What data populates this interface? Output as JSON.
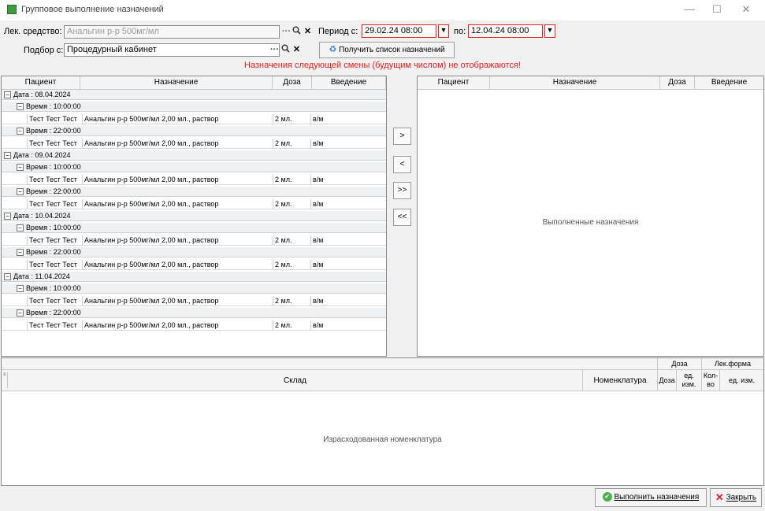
{
  "window": {
    "title": "Групповое выполнение назначений",
    "minimize": "—",
    "maximize": "☐",
    "close": "✕"
  },
  "filters": {
    "drug_label": "Лек. средство:",
    "drug_value": "Анальгин р-р 500мг/мл",
    "period_from_label": "Период с:",
    "period_from_value": "29.02.24 08:00",
    "period_to_label": "по:",
    "period_to_value": "12.04.24 08:00",
    "selection_label": "Подбор с:",
    "selection_value": "Процедурный кабинет",
    "get_list_button": "Получить список назначений",
    "warning": "Назначения следующей смены (будущим числом) не отображаются!"
  },
  "left_grid": {
    "columns": [
      "Пациент",
      "Назначение",
      "Доза",
      "Введение"
    ],
    "rows": [
      {
        "kind": "date",
        "label": "Дата : 08.04.2024"
      },
      {
        "kind": "time",
        "label": "Время : 10:00:00"
      },
      {
        "kind": "data",
        "patient": "Тест Тест Тест",
        "order": "Анальгин р-р 500мг/мл 2,00 мл., раствор",
        "dose": "2 мл.",
        "route": "в/м"
      },
      {
        "kind": "time",
        "label": "Время : 22:00:00"
      },
      {
        "kind": "data",
        "patient": "Тест Тест Тест",
        "order": "Анальгин р-р 500мг/мл 2,00 мл., раствор",
        "dose": "2 мл.",
        "route": "в/м"
      },
      {
        "kind": "date",
        "label": "Дата : 09.04.2024"
      },
      {
        "kind": "time",
        "label": "Время : 10:00:00"
      },
      {
        "kind": "data",
        "patient": "Тест Тест Тест",
        "order": "Анальгин р-р 500мг/мл 2,00 мл., раствор",
        "dose": "2 мл.",
        "route": "в/м"
      },
      {
        "kind": "time",
        "label": "Время : 22:00:00"
      },
      {
        "kind": "data",
        "patient": "Тест Тест Тест",
        "order": "Анальгин р-р 500мг/мл 2,00 мл., раствор",
        "dose": "2 мл.",
        "route": "в/м"
      },
      {
        "kind": "date",
        "label": "Дата : 10.04.2024"
      },
      {
        "kind": "time",
        "label": "Время : 10:00:00"
      },
      {
        "kind": "data",
        "patient": "Тест Тест Тест",
        "order": "Анальгин р-р 500мг/мл 2,00 мл., раствор",
        "dose": "2 мл.",
        "route": "в/м"
      },
      {
        "kind": "time",
        "label": "Время : 22:00:00"
      },
      {
        "kind": "data",
        "patient": "Тест Тест Тест",
        "order": "Анальгин р-р 500мг/мл 2,00 мл., раствор",
        "dose": "2 мл.",
        "route": "в/м"
      },
      {
        "kind": "date",
        "label": "Дата : 11.04.2024"
      },
      {
        "kind": "time",
        "label": "Время : 10:00:00"
      },
      {
        "kind": "data",
        "patient": "Тест Тест Тест",
        "order": "Анальгин р-р 500мг/мл 2,00 мл., раствор",
        "dose": "2 мл.",
        "route": "в/м"
      },
      {
        "kind": "time",
        "label": "Время : 22:00:00"
      },
      {
        "kind": "data",
        "patient": "Тест Тест Тест",
        "order": "Анальгин р-р 500мг/мл 2,00 мл., раствор",
        "dose": "2 мл.",
        "route": "в/м"
      }
    ]
  },
  "transfer": {
    "move_one": ">",
    "move_back": "<",
    "move_all": ">>",
    "move_all_back": "<<"
  },
  "right_grid": {
    "columns": [
      "Пациент",
      "Назначение",
      "Доза",
      "Введение"
    ],
    "placeholder": "Выполненные назначения"
  },
  "bottom_grid": {
    "group_dose": "Доза",
    "group_form": "Лек.форма",
    "col_warehouse": "Склад",
    "col_nomenclature": "Номенклатура",
    "col_dose": "Доза",
    "col_unit1_a": "ед.",
    "col_unit1_b": "изм.",
    "col_qty_a": "Кол-",
    "col_qty_b": "во",
    "col_unit2": "ед. изм.",
    "placeholder": "Израсходованная номенклатура"
  },
  "actions": {
    "execute": "Выполнить назначения",
    "close": "Закрыть"
  }
}
